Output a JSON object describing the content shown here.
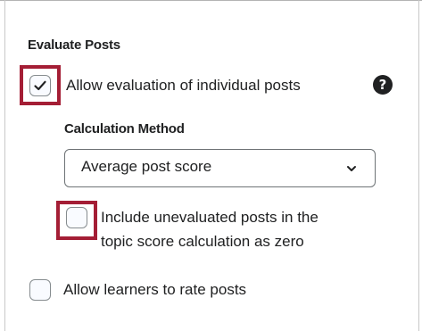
{
  "evaluate_posts": {
    "section_title": "Evaluate Posts",
    "allow_evaluation": {
      "label": "Allow evaluation of individual posts",
      "checked": true
    },
    "help_icon": "?",
    "calculation_method": {
      "title": "Calculation Method",
      "selected_value": "Average post score"
    },
    "include_unevaluated": {
      "label_line1": "Include unevaluated posts in the",
      "label_line2": "topic score calculation as zero",
      "checked": false
    },
    "allow_rating": {
      "label": "Allow learners to rate posts",
      "checked": false
    }
  },
  "colors": {
    "highlight": "#a41e35",
    "checkbox_border": "#868c8f",
    "text": "#202122"
  },
  "icons": {
    "check": "checkmark-icon",
    "help": "help-icon",
    "chevron": "chevron-down-icon"
  }
}
